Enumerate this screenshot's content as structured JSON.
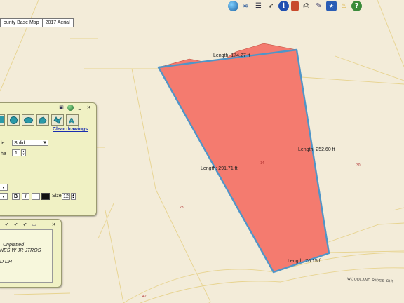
{
  "basemap_tabs": [
    {
      "label": "ounty Base Map",
      "active": true
    },
    {
      "label": "2017 Aerial",
      "active": false
    }
  ],
  "toolbar_icons": [
    "globe-icon",
    "layers-icon",
    "legend-icon",
    "measure-icon",
    "info-icon",
    "bookmark-icon",
    "print-icon",
    "tools-icon",
    "badge-icon",
    "lightbulb-icon",
    "help-icon"
  ],
  "measurements": {
    "top": "Length: 174.27 ft",
    "right": "Length: 252.60 ft",
    "left": "Length: 291.71 ft",
    "bottom": "Length: 76.15 ft"
  },
  "parcel_numbers": {
    "inside": "14",
    "east": "30",
    "west": "28",
    "south": "42"
  },
  "street_name": "WOODLAND RIDGE CIR",
  "draw_panel": {
    "clear_label": "Clear drawings",
    "style_label": "le",
    "style_value": "Solid",
    "alpha_label": "ha",
    "alpha_value": "1",
    "bold": "B",
    "italic": "I",
    "size_label": "Size",
    "size_value": "12"
  },
  "identify_panel": {
    "line1": "Unplatted",
    "line2": "NES W JR JTROS",
    "line3": "D DR"
  },
  "colors": {
    "map_bg": "#f3ecd9",
    "polygon_fill": "#f47b6f",
    "polygon_stroke": "#4f95c8",
    "parcel_line": "#e7d38f",
    "panel_bg": "#f0f1c4",
    "link": "#1a2fb0"
  }
}
